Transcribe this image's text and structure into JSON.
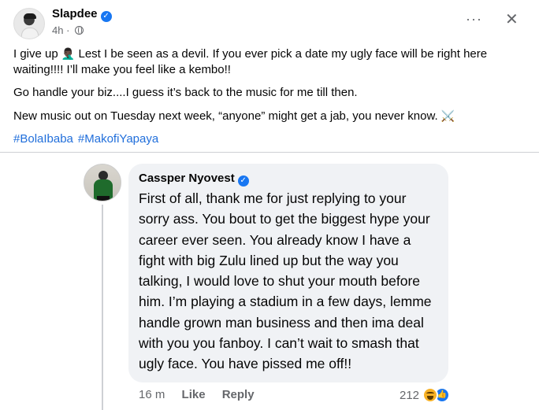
{
  "post": {
    "author": "Slapdee",
    "time": "4h",
    "more_glyph": "···",
    "close_glyph": "✕",
    "paragraphs": {
      "p1_a": "I give up",
      "p1_emoji": "🤦🏿‍♂️",
      "p1_b": " Lest I be seen as a devil. If you ever pick a date my ugly face will be right here waiting!!!! I’ll make you feel like a kembo!!",
      "p2": "Go handle your biz....I guess it’s back to the music for me till then.",
      "p3_a": "New music out on Tuesday next week, “anyone” might get a jab, you never know.",
      "p3_emoji": "⚔️"
    },
    "hashtags": [
      "#BolaIbaba",
      "#MakofiYapaya"
    ]
  },
  "comment": {
    "author": "Cassper Nyovest",
    "text": "First of all, thank me for just replying to your sorry ass. You bout to get the biggest hype your career ever seen. You already know I have a fight with big Zulu lined up but the way you talking, I would love to shut your mouth before him. I’m playing a stadium in a few days, lemme handle grown man business and then ima deal with you you fanboy. I can’t wait to smash that ugly face. You have pissed me off!!",
    "time": "16 m",
    "like_label": "Like",
    "reply_label": "Reply",
    "reaction_count": "212",
    "reactions": [
      "haha-icon",
      "like-icon"
    ]
  },
  "colors": {
    "verified": "#1877f2",
    "hashtag": "#216fdb",
    "bubble": "#f0f2f5",
    "meta": "#65676b"
  }
}
